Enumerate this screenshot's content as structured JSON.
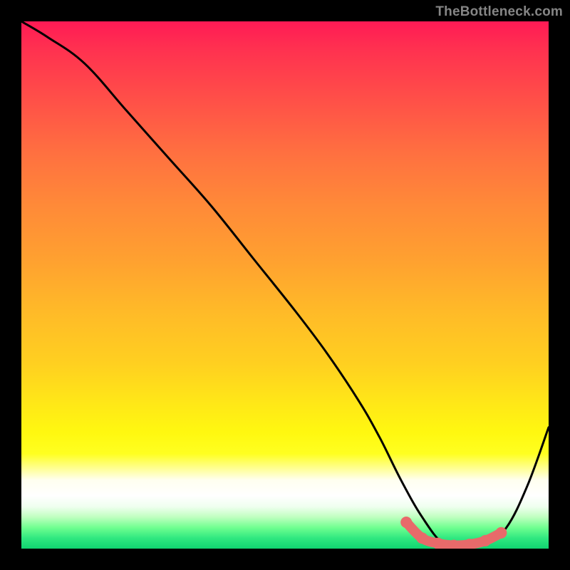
{
  "watermark": "TheBottleneck.com",
  "colors": {
    "page_bg": "#000000",
    "curve": "#000000",
    "highlight": "#e86a6a",
    "text": "#858585"
  },
  "chart_data": {
    "type": "line",
    "title": "",
    "xlabel": "",
    "ylabel": "",
    "xlim": [
      0,
      100
    ],
    "ylim": [
      0,
      100
    ],
    "grid": false,
    "legend": false,
    "series": [
      {
        "name": "bottleneck-curve",
        "x": [
          0,
          5,
          12,
          20,
          28,
          36,
          44,
          52,
          58,
          64,
          68,
          72,
          76,
          80,
          84,
          88,
          92,
          96,
          100
        ],
        "y": [
          100,
          97,
          92,
          83,
          74,
          65,
          55,
          45,
          37,
          28,
          21,
          13,
          6,
          1,
          0.5,
          0.8,
          4,
          12,
          23
        ]
      }
    ],
    "highlight_segment": {
      "name": "plateau-highlight",
      "x": [
        73,
        76,
        79,
        82,
        85,
        88,
        91
      ],
      "y": [
        5,
        2,
        1,
        0.6,
        0.8,
        1.5,
        3
      ]
    }
  }
}
